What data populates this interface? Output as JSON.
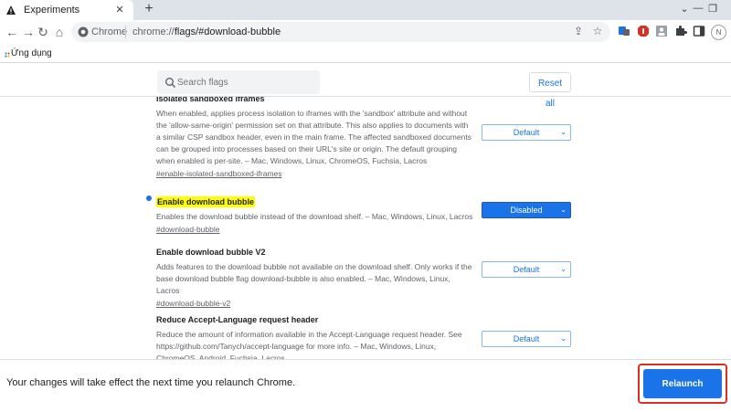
{
  "tab": {
    "title": "Experiments",
    "close": "✕",
    "favicon": "warning-triangle-icon"
  },
  "window": {
    "new_tab": "+",
    "minimize": "—",
    "restore": "❐",
    "chevron": "⌄"
  },
  "toolbar": {
    "back": "←",
    "forward": "→",
    "reload": "↻",
    "home": "⌂"
  },
  "omnibox": {
    "site_label": "Chrome",
    "url_scheme": "chrome://",
    "url_path": "flags/#download-bubble",
    "share": "⇪",
    "bookmark": "☆"
  },
  "extensions": {
    "icons": [
      "translate-icon",
      "adblock-icon",
      "profile-card-icon",
      "puzzle-icon",
      "sidebar-icon"
    ]
  },
  "profile": {
    "initial": "N"
  },
  "bookmarks": {
    "apps_label": "Ứng dụng"
  },
  "search": {
    "placeholder": "Search flags"
  },
  "reset": {
    "label": "Reset all"
  },
  "flags": [
    {
      "title": "Isolated sandboxed iframes",
      "desc": "When enabled, applies process isolation to iframes with the 'sandbox' attribute and without the 'allow-same-origin' permission set on that attribute. This also applies to documents with a similar CSP sandbox header, even in the main frame. The affected sandboxed documents can be grouped into processes based on their URL's site or origin. The default grouping when enabled is per-site. – Mac, Windows, Linux, ChromeOS, Fuchsia, Lacros",
      "anchor": "#enable-isolated-sandboxed-iframes",
      "value": "Default",
      "highlighted": false
    },
    {
      "title": "Enable download bubble",
      "desc": "Enables the download bubble instead of the download shelf. – Mac, Windows, Linux, Lacros",
      "anchor": "#download-bubble",
      "value": "Disabled",
      "highlighted": true
    },
    {
      "title": "Enable download bubble V2",
      "desc": "Adds features to the download bubble not available on the download shelf. Only works if the base download bubble flag download-bubble is also enabled. – Mac, Windows, Linux, Lacros",
      "anchor": "#download-bubble-v2",
      "value": "Default",
      "highlighted": false
    },
    {
      "title": "Reduce Accept-Language request header",
      "desc": "Reduce the amount of information available in the Accept-Language request header. See https://github.com/Tanych/accept-language for more info. – Mac, Windows, Linux, ChromeOS, Android, Fuchsia, Lacros",
      "anchor": "",
      "value": "Default",
      "highlighted": false
    }
  ],
  "bottom": {
    "message": "Your changes will take effect the next time you relaunch Chrome.",
    "relaunch_label": "Relaunch"
  },
  "colors": {
    "accent": "#1a73e8",
    "highlight": "#ffff00",
    "outline": "#d93025"
  }
}
